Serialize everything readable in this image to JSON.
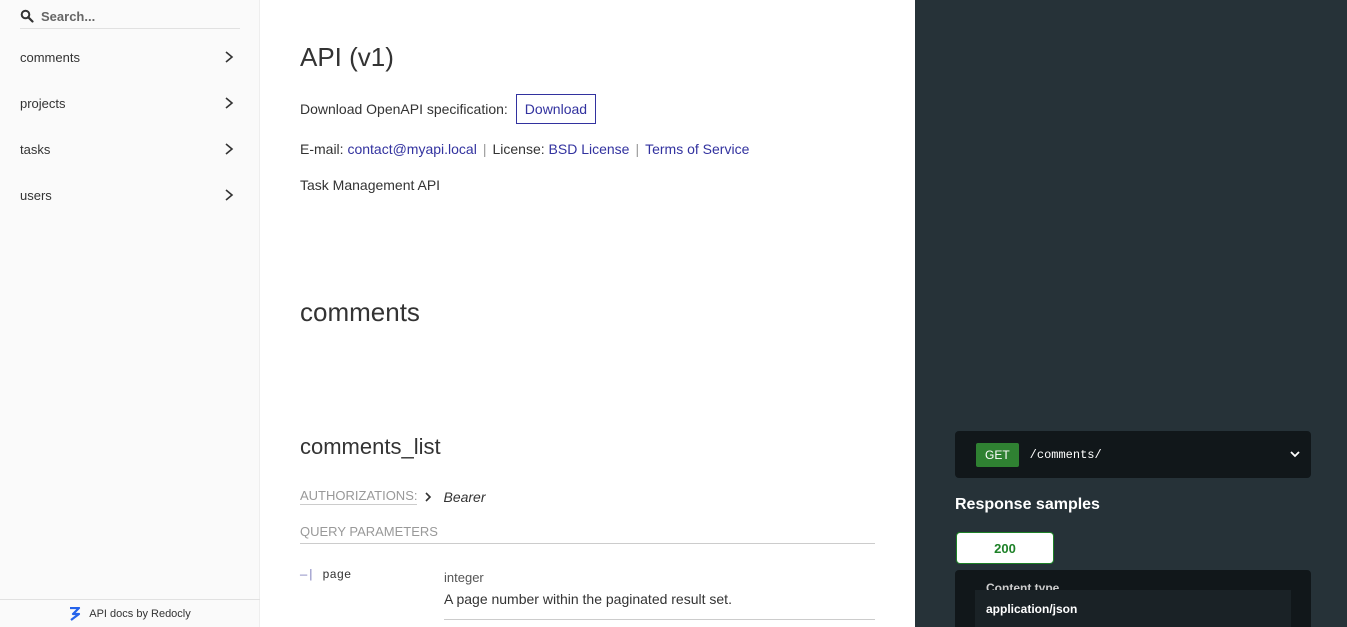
{
  "sidebar": {
    "search_placeholder": "Search...",
    "items": [
      {
        "label": "comments"
      },
      {
        "label": "projects"
      },
      {
        "label": "tasks"
      },
      {
        "label": "users"
      }
    ],
    "footer": "API docs by Redocly"
  },
  "main": {
    "title": "API (v1)",
    "download_label": "Download OpenAPI specification:",
    "download_button": "Download",
    "email_label": "E-mail:",
    "email": "contact@myapi.local",
    "license_label": "License:",
    "license": "BSD License",
    "terms": "Terms of Service",
    "description": "Task Management API",
    "tag_title": "comments",
    "operation_title": "comments_list",
    "authorizations_label": "Authorizations:",
    "authorizations_value": "Bearer",
    "query_params_label": "Query Parameters",
    "params": [
      {
        "name": "page",
        "type": "integer",
        "description": "A page number within the paginated result set."
      }
    ]
  },
  "right": {
    "method": "GET",
    "path": "/comments/",
    "response_samples_title": "Response samples",
    "status_tab": "200",
    "content_type_label": "Content type",
    "content_type_value": "application/json"
  },
  "colors": {
    "link": "#32329f",
    "get_method": "#2f8132",
    "right_panel": "#263238",
    "status_200": "#1d8127"
  }
}
